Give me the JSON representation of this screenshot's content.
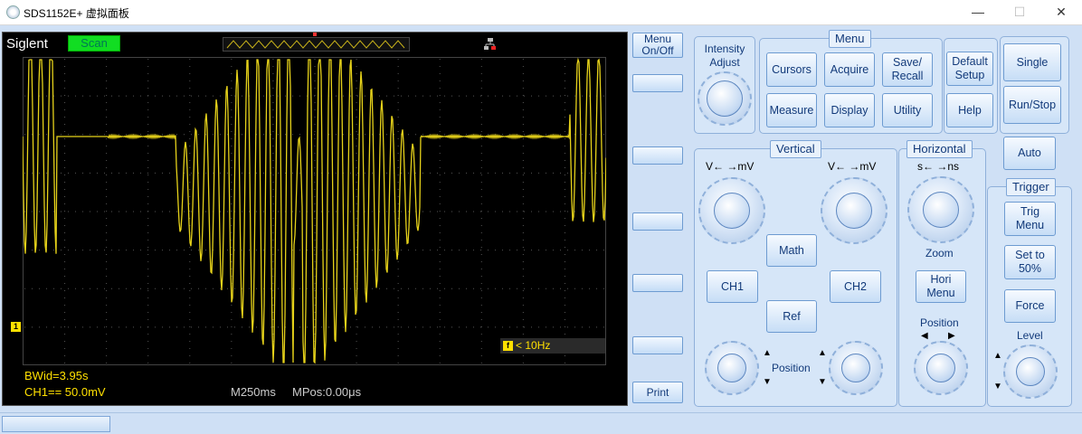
{
  "window": {
    "title": "SDS1152E+ 虚拟面板",
    "min_glyph": "—",
    "max_glyph": "☐",
    "close_glyph": "✕"
  },
  "screen": {
    "brand": "Siglent",
    "mode": "Scan",
    "ch1_marker": "1",
    "trigger_marker": "f",
    "trigger_freq": "< 10Hz",
    "bwid": "BWid=3.95s",
    "ch1_scale": "CH1== 50.0mV",
    "timebase": "M250ms",
    "mpos": "MPos:0.00μs",
    "trace_color": "#e6d21a"
  },
  "softkeys": {
    "menu_onoff": "Menu On/Off",
    "print": "Print"
  },
  "intensity": {
    "label": "Intensity Adjust"
  },
  "menu_group": {
    "title": "Menu",
    "cursors": "Cursors",
    "acquire": "Acquire",
    "save_recall": "Save/ Recall",
    "measure": "Measure",
    "display": "Display",
    "utility": "Utility"
  },
  "system": {
    "default_setup": "Default Setup",
    "help": "Help"
  },
  "run": {
    "single": "Single",
    "run_stop": "Run/Stop",
    "auto": "Auto"
  },
  "vertical": {
    "title": "Vertical",
    "ch1_volts_label": "V←  →mV",
    "ch2_volts_label": "V←  →mV",
    "math": "Math",
    "ch1": "CH1",
    "ch2": "CH2",
    "ref": "Ref",
    "position": "Position"
  },
  "horizontal": {
    "title": "Horizontal",
    "time_label": "s←  →ns",
    "zoom": "Zoom",
    "hori_menu": "Hori Menu",
    "position": "Position"
  },
  "trigger": {
    "title": "Trigger",
    "trig_menu": "Trig Menu",
    "set_50": "Set to 50%",
    "force": "Force",
    "level": "Level"
  },
  "colors": {
    "accent": "#123a7a",
    "panel": "#cfe0f5",
    "button_border": "#6d9bd1"
  }
}
